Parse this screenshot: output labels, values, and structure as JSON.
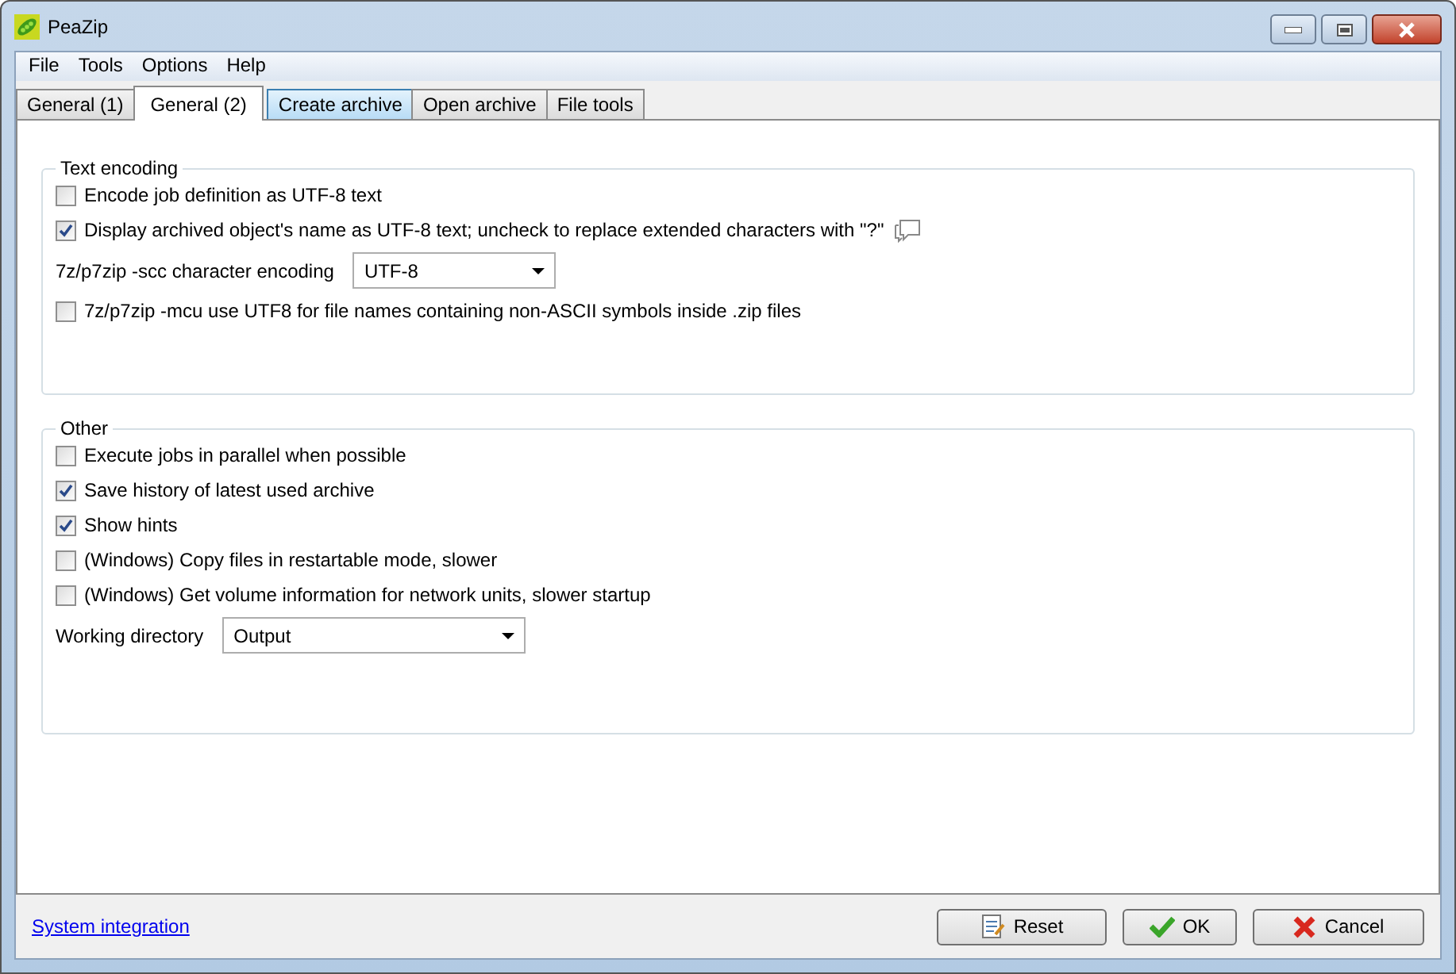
{
  "window": {
    "title": "PeaZip"
  },
  "menu": [
    "File",
    "Tools",
    "Options",
    "Help"
  ],
  "tabs": [
    {
      "label": "General (1)",
      "selected": false,
      "highlighted": false
    },
    {
      "label": "General (2)",
      "selected": true,
      "highlighted": false
    },
    {
      "label": "Create archive",
      "selected": false,
      "highlighted": true
    },
    {
      "label": "Open archive",
      "selected": false,
      "highlighted": false
    },
    {
      "label": "File tools",
      "selected": false,
      "highlighted": false
    }
  ],
  "groups": [
    {
      "title": "Text encoding",
      "items": [
        {
          "kind": "checkbox",
          "label": "Encode job definition as UTF-8 text",
          "checked": false
        },
        {
          "kind": "checkbox",
          "label": "Display archived object's name as UTF-8 text; uncheck to replace extended characters with \"?\"",
          "checked": true,
          "hint": true
        },
        {
          "kind": "dropdown",
          "label": "7z/p7zip -scc character encoding",
          "value": "UTF-8"
        },
        {
          "kind": "checkbox",
          "label": "7z/p7zip -mcu use UTF8 for file names containing non-ASCII symbols inside .zip files",
          "checked": false
        }
      ]
    },
    {
      "title": "Other",
      "items": [
        {
          "kind": "checkbox",
          "label": "Execute jobs in parallel when possible",
          "checked": false
        },
        {
          "kind": "checkbox",
          "label": "Save history of latest used archive",
          "checked": true
        },
        {
          "kind": "checkbox",
          "label": "Show hints",
          "checked": true
        },
        {
          "kind": "checkbox",
          "label": "(Windows) Copy files in restartable mode, slower",
          "checked": false
        },
        {
          "kind": "checkbox",
          "label": "(Windows) Get volume information for network units, slower startup",
          "checked": false
        },
        {
          "kind": "dropdown",
          "label": "Working directory",
          "value": "Output"
        }
      ]
    }
  ],
  "footer": {
    "link": "System integration",
    "buttons": [
      {
        "kind": "reset",
        "label": "Reset"
      },
      {
        "kind": "ok",
        "label": "OK"
      },
      {
        "kind": "cancel",
        "label": "Cancel"
      }
    ]
  }
}
